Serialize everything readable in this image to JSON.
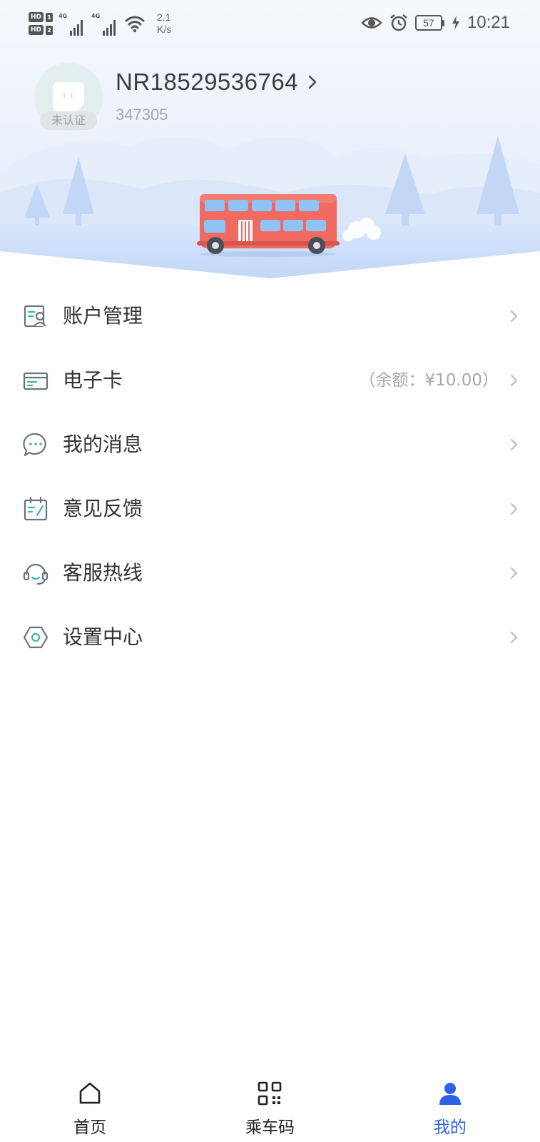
{
  "status_bar": {
    "sim1": "HD",
    "sim1_num": "1",
    "sim2": "HD",
    "sim2_num": "2",
    "net1": "4G",
    "net2": "4G",
    "speed_value": "2.1",
    "speed_unit": "K/s",
    "battery": "57",
    "time": "10:21",
    "icons": [
      "eye-icon",
      "alarm-icon",
      "battery-icon",
      "charging-icon",
      "wifi-icon",
      "signal-icon"
    ]
  },
  "profile": {
    "username": "NR18529536764",
    "user_id": "347305",
    "verify_status": "未认证"
  },
  "menu": {
    "items": [
      {
        "label": "账户管理",
        "value": "",
        "icon": "account-icon"
      },
      {
        "label": "电子卡",
        "value": "（余额：¥10.00）",
        "icon": "card-icon"
      },
      {
        "label": "我的消息",
        "value": "",
        "icon": "message-icon"
      },
      {
        "label": "意见反馈",
        "value": "",
        "icon": "feedback-icon"
      },
      {
        "label": "客服热线",
        "value": "",
        "icon": "headset-icon"
      },
      {
        "label": "设置中心",
        "value": "",
        "icon": "settings-icon"
      }
    ]
  },
  "bottom_nav": {
    "items": [
      {
        "label": "首页",
        "icon": "home-icon",
        "active": false
      },
      {
        "label": "乘车码",
        "icon": "qr-code-icon",
        "active": false
      },
      {
        "label": "我的",
        "icon": "user-icon",
        "active": true
      }
    ]
  },
  "colors": {
    "accent": "#2c62e6",
    "icon_teal": "#3bb8a8",
    "icon_gray": "#6b7378",
    "bus_red": "#f06a62",
    "sky": "#dde9fb"
  }
}
